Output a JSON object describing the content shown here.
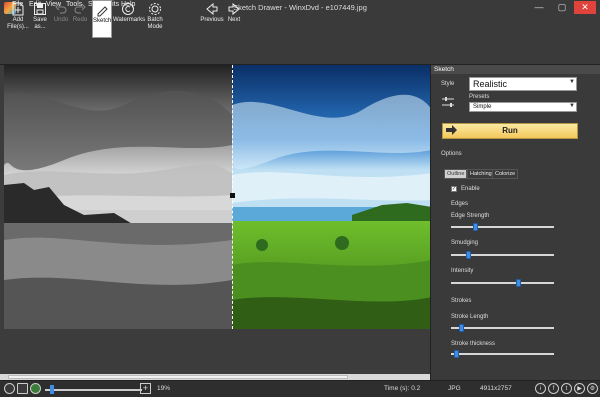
{
  "window": {
    "title": "Sketch Drawer - WinxDvd - e107449.jpg",
    "minimize": "—",
    "maximize": "▢",
    "close": "✕"
  },
  "menu": [
    "File",
    "Edit",
    "View",
    "Tools",
    "SoftOrbits",
    "Help"
  ],
  "toolbar": {
    "add_files": "Add File(s)...",
    "save_as": "Save as...",
    "undo": "Undo",
    "redo": "Redo",
    "sketch": "Sketch",
    "watermarks": "Watermarks",
    "batch_mode": "Batch Mode",
    "previous": "Previous",
    "next": "Next"
  },
  "panel": {
    "header": "Sketch",
    "style_label": "Style",
    "style_value": "Realistic",
    "presets_label": "Presets",
    "presets_value": "Simple",
    "run_label": "Run",
    "options_label": "Options",
    "tabs": [
      "Outline",
      "Hatching",
      "Colorize"
    ],
    "enable_label": "Enable",
    "enable_checked": true,
    "edges_label": "Edges",
    "edge_strength_label": "Edge Strength",
    "edge_strength": 0.22,
    "smudging_label": "Smudging",
    "smudging": 0.15,
    "intensity_label": "Intensity",
    "intensity": 0.66,
    "strokes_label": "Strokes",
    "stroke_length_label": "Stroke Length",
    "stroke_length": 0.08,
    "stroke_thickness_label": "Stroke thickness",
    "stroke_thickness": 0.03
  },
  "status": {
    "zoom": "19%",
    "zoom_level": 0.05,
    "time": "Time (s): 0.2",
    "format": "JPG",
    "dimensions": "4911x2757"
  },
  "colors": {
    "accent": "#3d8ee6",
    "run_button": "#f3c85b",
    "close_button": "#e0433b"
  }
}
